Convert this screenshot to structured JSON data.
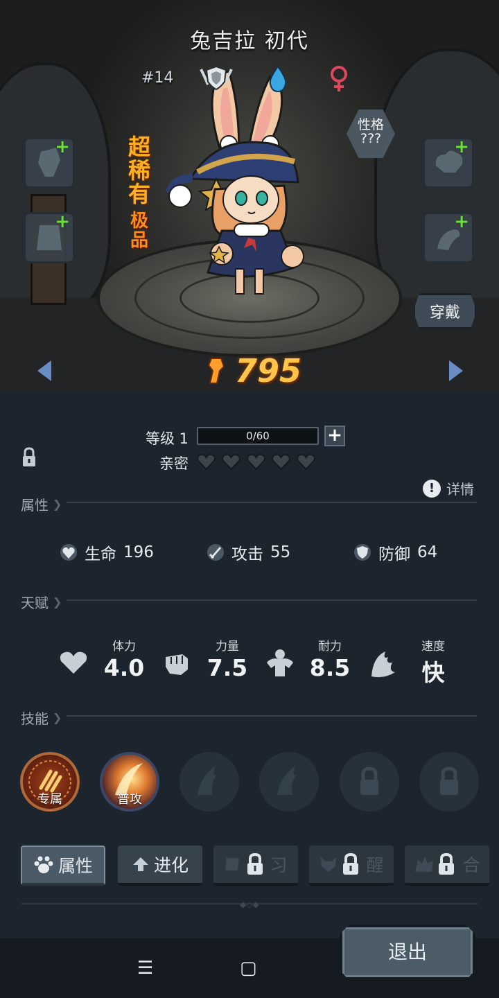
{
  "character": {
    "name": "兔吉拉 初代",
    "number": "#14",
    "rarity": "超稀有",
    "grade": "极品",
    "personality_label": "性格",
    "personality_value": "???",
    "wear_label": "穿戴",
    "power": "795",
    "badges": [
      "shield-rank-icon",
      "water-element-icon",
      "female-icon"
    ]
  },
  "level": {
    "label": "等级 1",
    "progress_text": "0/60",
    "progress": 0
  },
  "affection": {
    "label": "亲密",
    "hearts_filled": 0,
    "hearts_total": 5
  },
  "details_label": "详情",
  "sections": {
    "attributes": "属性",
    "talent": "天赋",
    "skills": "技能"
  },
  "stats": [
    {
      "label": "生命",
      "value": "196",
      "icon": "heart-shield-icon"
    },
    {
      "label": "攻击",
      "value": "55",
      "icon": "sword-icon"
    },
    {
      "label": "防御",
      "value": "64",
      "icon": "shield-icon"
    }
  ],
  "talents": [
    {
      "label": "体力",
      "value": "4.0",
      "icon": "heart-icon"
    },
    {
      "label": "力量",
      "value": "7.5",
      "icon": "fist-icon"
    },
    {
      "label": "耐力",
      "value": "8.5",
      "icon": "muscle-icon"
    },
    {
      "label": "速度",
      "value": "快",
      "icon": "wing-icon"
    }
  ],
  "skills": [
    {
      "label": "专属",
      "state": "unlocked"
    },
    {
      "label": "普攻",
      "state": "unlocked"
    },
    {
      "label": "",
      "state": "empty"
    },
    {
      "label": "",
      "state": "empty"
    },
    {
      "label": "",
      "state": "locked"
    },
    {
      "label": "",
      "state": "locked"
    }
  ],
  "tabs": [
    {
      "label": "属性",
      "state": "active"
    },
    {
      "label": "进化",
      "state": "normal"
    },
    {
      "label": "习",
      "state": "locked"
    },
    {
      "label": "醒",
      "state": "locked"
    },
    {
      "label": "合",
      "state": "locked"
    }
  ],
  "exit_label": "退出",
  "colors": {
    "power": "#ffc44a",
    "rarity": "#ffb020",
    "panel": "#1c252d",
    "add_green": "#6cde3a"
  }
}
